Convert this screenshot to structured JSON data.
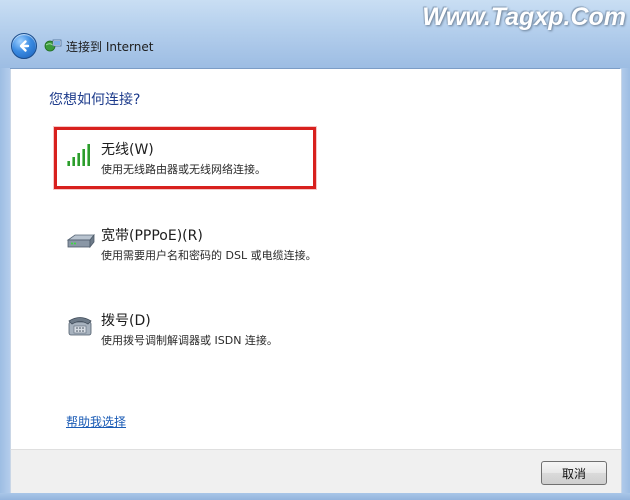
{
  "window": {
    "title": "连接到 Internet",
    "watermark": "Www.Tagxp.Com"
  },
  "main": {
    "question": "您想如何连接?",
    "options": [
      {
        "title": "无线(W)",
        "description": "使用无线路由器或无线网络连接。",
        "icon": "wireless-signal-icon",
        "selected": true
      },
      {
        "title": "宽带(PPPoE)(R)",
        "description": "使用需要用户名和密码的 DSL 或电缆连接。",
        "icon": "broadband-modem-icon",
        "selected": false
      },
      {
        "title": "拨号(D)",
        "description": "使用拨号调制解调器或 ISDN 连接。",
        "icon": "dialup-phone-icon",
        "selected": false
      }
    ],
    "help_link": "帮助我选择"
  },
  "footer": {
    "cancel_label": "取消"
  },
  "colors": {
    "highlight": "#d8201e",
    "link": "#1a5bb5",
    "question": "#1e3c8c"
  }
}
